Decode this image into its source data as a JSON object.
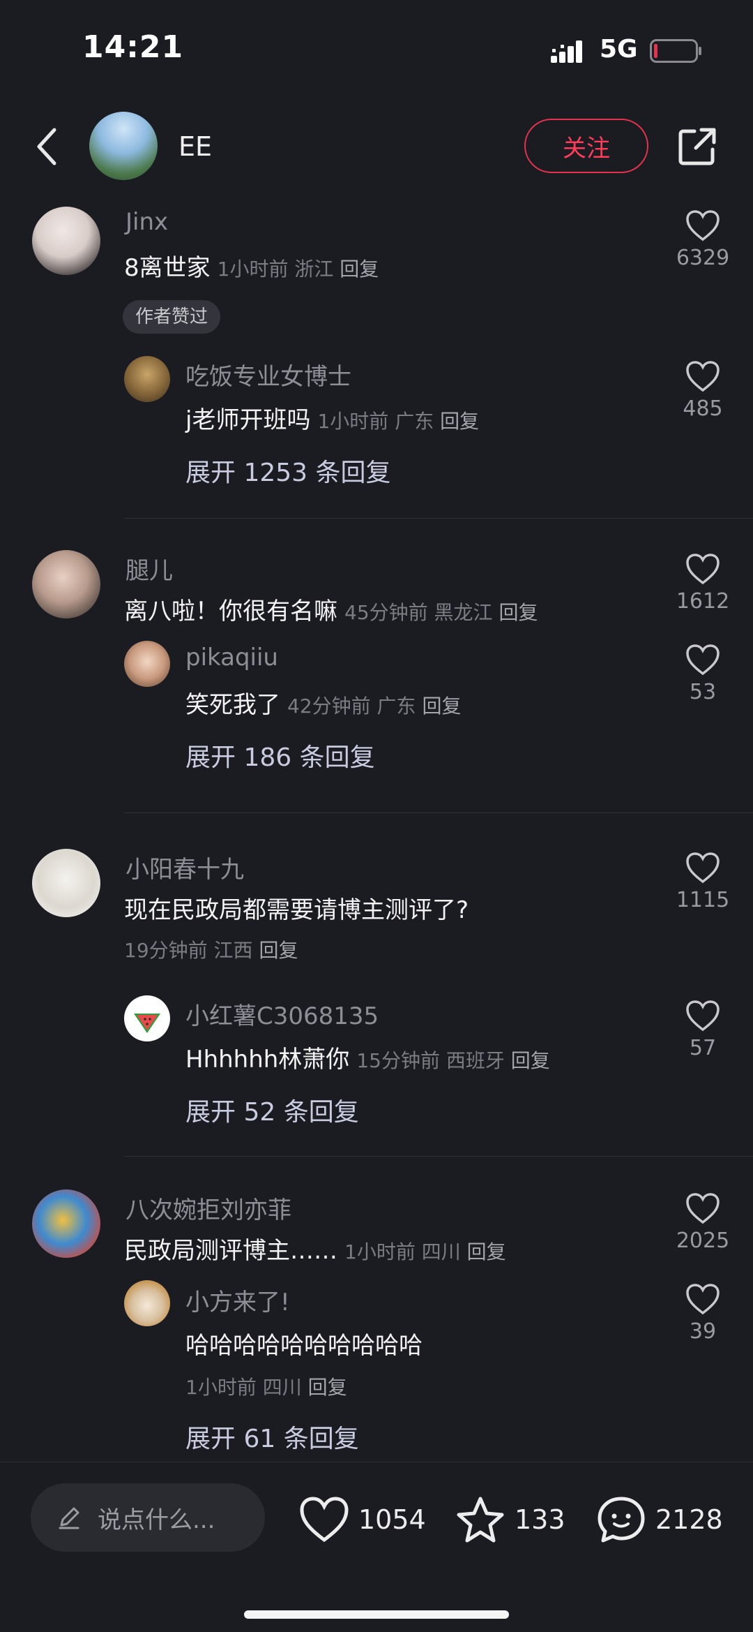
{
  "status": {
    "time": "14:21",
    "network": "5G"
  },
  "header": {
    "author_name": "EE",
    "follow_label": "关注"
  },
  "comments": [
    {
      "username": "Jinx",
      "text": "8离世家",
      "time": "1小时前",
      "location": "浙江",
      "reply_label": "回复",
      "likes": "6329",
      "badge": "作者赞过",
      "reply": {
        "username": "吃饭专业女博士",
        "text": "j老师开班吗",
        "time": "1小时前",
        "location": "广东",
        "reply_label": "回复",
        "likes": "485"
      },
      "expand_label": "展开 1253 条回复"
    },
    {
      "username": "腿儿",
      "text": "离八啦！你很有名嘛",
      "time": "45分钟前",
      "location": "黑龙江",
      "reply_label": "回复",
      "likes": "1612",
      "reply": {
        "username": "pikaqiiu",
        "text": "笑死我了",
        "time": "42分钟前",
        "location": "广东",
        "reply_label": "回复",
        "likes": "53"
      },
      "expand_label": "展开 186 条回复"
    },
    {
      "username": "小阳春十九",
      "text": "现在民政局都需要请博主测评了?",
      "time": "19分钟前",
      "location": "江西",
      "reply_label": "回复",
      "likes": "1115",
      "reply": {
        "username": "小红薯C3068135",
        "text": "Hhhhhh林萧你",
        "time": "15分钟前",
        "location": "西班牙",
        "reply_label": "回复",
        "likes": "57"
      },
      "expand_label": "展开 52 条回复"
    },
    {
      "username": "八次婉拒刘亦菲",
      "text": "民政局测评博主……",
      "time": "1小时前",
      "location": "四川",
      "reply_label": "回复",
      "likes": "2025",
      "reply": {
        "username": "小方来了!",
        "text": "哈哈哈哈哈哈哈哈哈哈",
        "time": "1小时前",
        "location": "四川",
        "reply_label": "回复",
        "likes": "39"
      },
      "expand_label": "展开 61 条回复"
    }
  ],
  "bottom": {
    "input_placeholder": "说点什么...",
    "likes": "1054",
    "stars": "133",
    "comments": "2128"
  },
  "colors": {
    "background": "#1b1b22",
    "accent": "#ff3d5a",
    "battery_low": "#e6334d"
  }
}
